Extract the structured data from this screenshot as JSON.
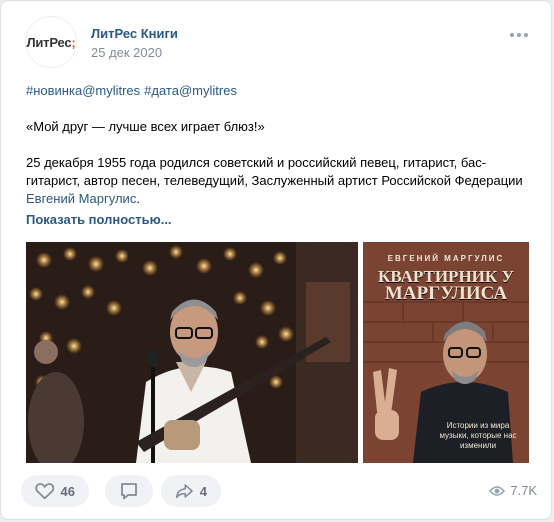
{
  "post": {
    "group_name": "ЛитРес Книги",
    "date": "25 дек 2020",
    "avatar": {
      "logo_text": "ЛитРес",
      "logo_mark": ";"
    },
    "hashtags": [
      "#новинка@mylitres",
      "#дата@mylitres"
    ],
    "quote": "«Мой друг — лучше всех играет блюз!»",
    "body_text": "25 декабря 1955 года родился советский и российский певец, гитарист, бас-гитарист, автор песен, телеведущий, Заслуженный артист Российской Федерации",
    "body_link": "Евгений Маргулис",
    "body_tail": ".",
    "show_more": "Показать полностью..."
  },
  "cover": {
    "author": "ЕВГЕНИЙ МАРГУЛИС",
    "title_line1": "КВАРТИРНИК У",
    "title_line2": "МАРГУЛИСА",
    "subtitle": "Истории из мира музыки, которые нас изменили"
  },
  "footer": {
    "likes": "46",
    "shares": "4",
    "views": "7.7K"
  },
  "colors": {
    "link": "#2a5885",
    "accent": "#ff4c00",
    "muted": "#818c99",
    "pill_bg": "#f0f2f5"
  },
  "icons": {
    "like": "heart-icon",
    "comment": "comment-icon",
    "share": "share-icon",
    "views": "eye-icon",
    "more": "more-dots-icon"
  }
}
